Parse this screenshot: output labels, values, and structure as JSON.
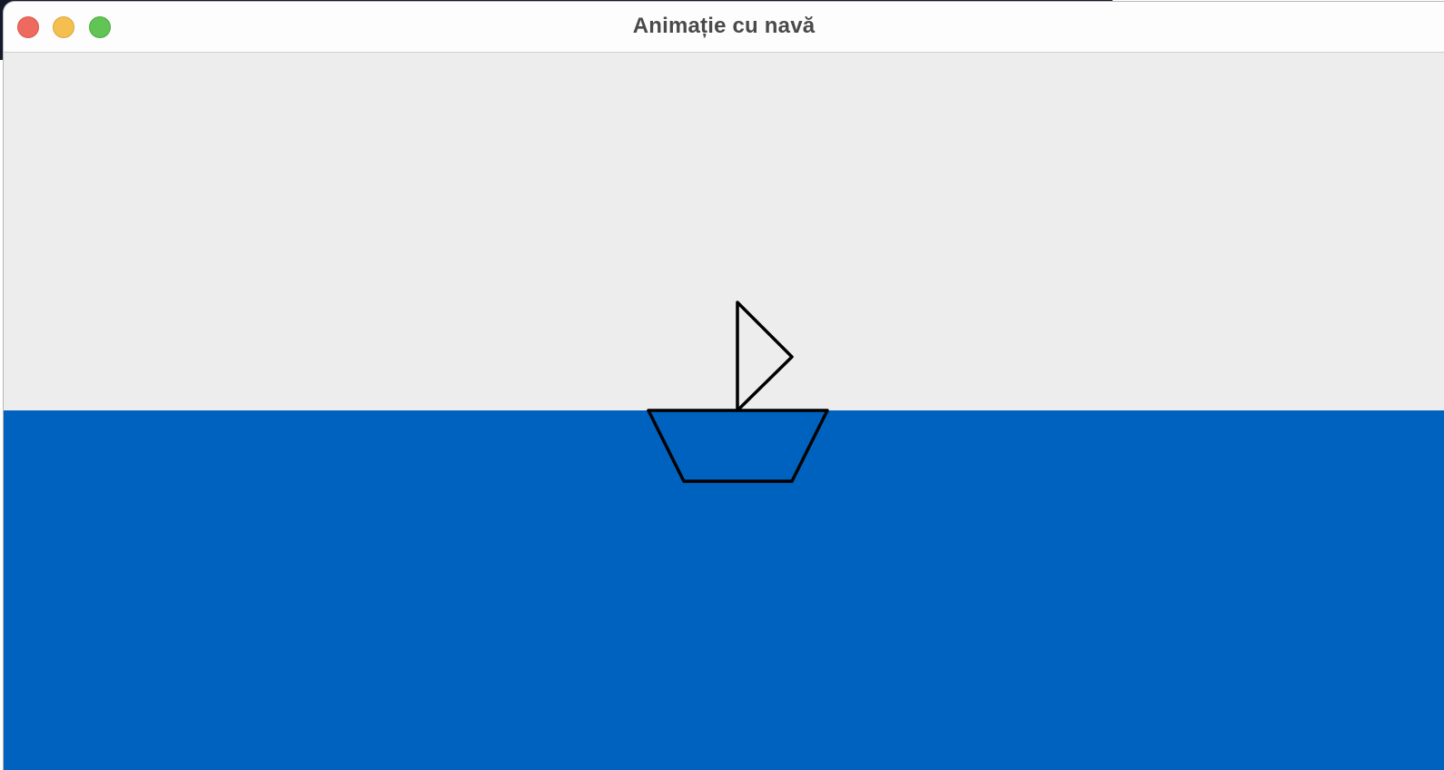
{
  "window": {
    "title": "Animație cu navă"
  },
  "colors": {
    "sky": "#ededed",
    "sea": "#0062bf",
    "boat_outline": "#000000"
  }
}
